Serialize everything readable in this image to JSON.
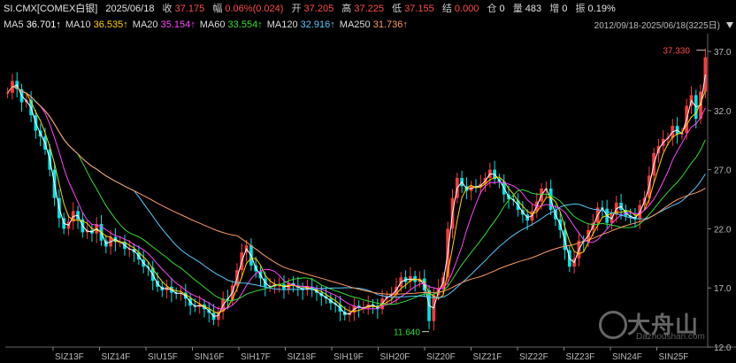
{
  "header": {
    "symbol": "SI.CMX[COMEX白银]",
    "date": "2025/06/18",
    "close_label": "收",
    "close_value": "37.175",
    "change_label": "幅",
    "change_value": "0.06%(0.024)",
    "open_label": "开",
    "open_value": "37.205",
    "high_label": "高",
    "high_value": "37.225",
    "low_label": "低",
    "low_value": "37.155",
    "settle_label": "结",
    "settle_value": "0.000",
    "oi_label": "仓",
    "oi_value": "0",
    "vol_label": "量",
    "vol_value": "483",
    "inc_label": "增",
    "inc_value": "0",
    "amp_label": "振",
    "amp_value": "0.19%"
  },
  "ma_bar": {
    "items": [
      {
        "label": "MA5",
        "value": "36.701↑",
        "color": "#ffffff"
      },
      {
        "label": "MA10",
        "value": "36.535↑",
        "color": "#ffd700"
      },
      {
        "label": "MA20",
        "value": "35.154↑",
        "color": "#ff44ff"
      },
      {
        "label": "MA60",
        "value": "33.554↑",
        "color": "#33dd33"
      },
      {
        "label": "MA120",
        "value": "32.916↑",
        "color": "#55ccff"
      },
      {
        "label": "MA250",
        "value": "31.736↑",
        "color": "#ff9966"
      }
    ],
    "range": "2012/09/18-2025/06/18(3225日)"
  },
  "chart_data": {
    "type": "candlestick",
    "ylim": [
      12.0,
      38.5
    ],
    "yticks": [
      "37.0",
      "32.0",
      "27.0",
      "22.0",
      "17.0",
      "12.0"
    ],
    "xticks": [
      "SIZ13F",
      "SIZ14F",
      "SIU15F",
      "SIN16F",
      "SIH17F",
      "SIZ18F",
      "SIH19F",
      "SIH20F",
      "SIZ20F",
      "SIZ21F",
      "SIZ22F",
      "SIZ23F",
      "SIN24F",
      "SIN25F"
    ],
    "high_mark": "37.330",
    "low_mark": "11.640",
    "colors": {
      "up": "#ff3b3b",
      "down": "#00e5e5"
    },
    "series_close": [
      33.5,
      34.5,
      33.8,
      32.7,
      32.9,
      31.6,
      30.3,
      29.8,
      28.7,
      27.0,
      24.6,
      22.9,
      22.0,
      22.6,
      23.5,
      22.8,
      21.7,
      21.9,
      21.6,
      22.4,
      21.0,
      20.5,
      21.3,
      20.9,
      20.9,
      20.3,
      20.3,
      20.0,
      19.4,
      18.8,
      18.7,
      17.6,
      17.1,
      16.8,
      17.1,
      16.6,
      16.5,
      16.6,
      16.1,
      15.5,
      15.4,
      15.6,
      15.2,
      14.9,
      14.3,
      15.0,
      16.1,
      16.0,
      17.2,
      18.5,
      20.0,
      20.6,
      18.9,
      18.4,
      17.8,
      17.1,
      17.1,
      17.3,
      17.3,
      16.9,
      17.4,
      17.2,
      17.0,
      16.8,
      17.1,
      16.8,
      16.6,
      16.3,
      16.1,
      15.7,
      15.6,
      15.0,
      14.7,
      14.9,
      15.5,
      15.3,
      15.3,
      15.6,
      15.5,
      15.2,
      16.1,
      16.3,
      16.5,
      17.1,
      17.9,
      17.5,
      18.0,
      17.5,
      17.8,
      16.8,
      14.2,
      16.4,
      17.0,
      17.9,
      22.0,
      24.6,
      26.3,
      25.6,
      25.2,
      25.6,
      25.5,
      25.8,
      26.3,
      27.0,
      26.2,
      26.0,
      24.9,
      24.5,
      24.4,
      23.6,
      23.2,
      22.7,
      23.5,
      24.3,
      25.4,
      25.4,
      23.6,
      22.8,
      21.9,
      20.2,
      18.8,
      19.5,
      21.0,
      20.9,
      21.9,
      22.5,
      23.8,
      23.7,
      22.5,
      23.2,
      24.2,
      23.6,
      23.1,
      23.0,
      22.8,
      24.0,
      24.6,
      26.5,
      28.4,
      29.0,
      29.6,
      29.7,
      30.7,
      30.0,
      30.1,
      32.4,
      33.3,
      31.3,
      33.6,
      36.5
    ]
  }
}
